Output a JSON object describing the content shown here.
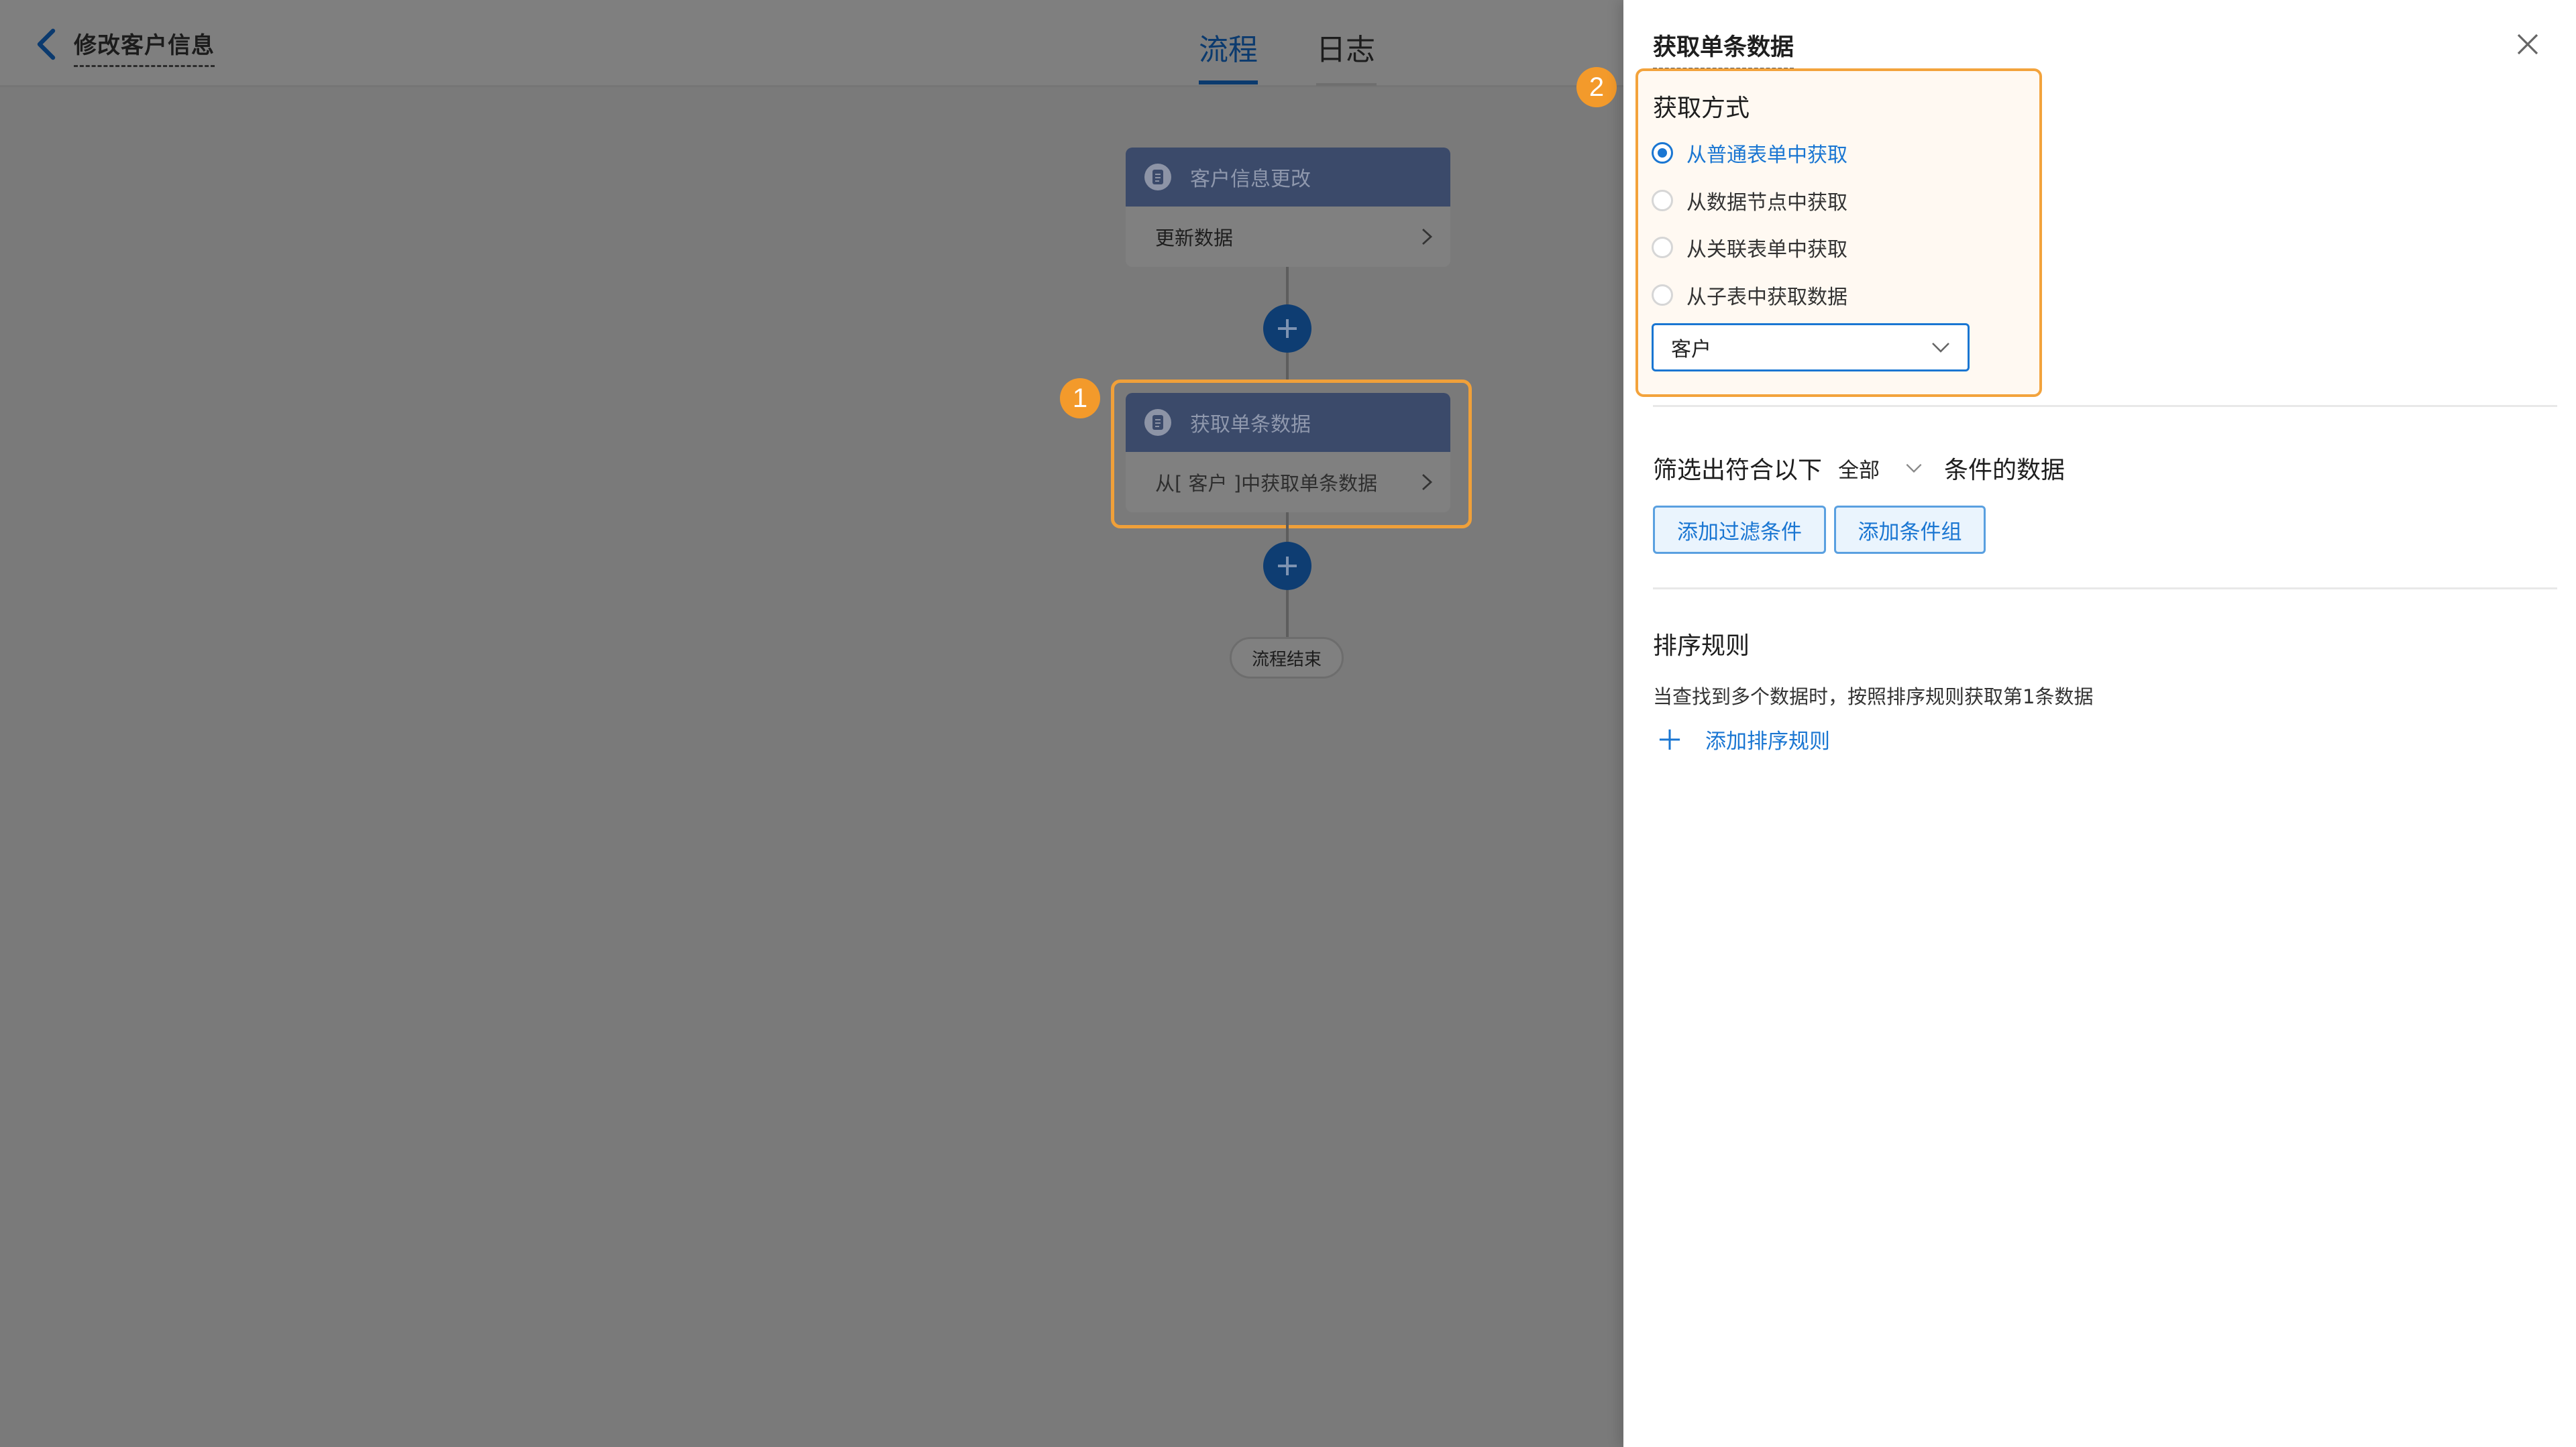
{
  "header": {
    "page_title": "修改客户信息",
    "tabs": [
      {
        "label": "流程",
        "active": true
      },
      {
        "label": "日志",
        "active": false
      }
    ]
  },
  "flow": {
    "nodes": [
      {
        "title": "客户信息更改",
        "body": "更新数据",
        "icon": "form-icon"
      },
      {
        "title": "获取单条数据",
        "body": "从[ 客户 ]中获取单条数据",
        "icon": "form-icon"
      }
    ],
    "end_label": "流程结束",
    "step_badges": [
      "1",
      "2"
    ]
  },
  "panel": {
    "title": "获取单条数据",
    "method_label": "获取方式",
    "methods": [
      {
        "label": "从普通表单中获取",
        "checked": true
      },
      {
        "label": "从数据节点中获取",
        "checked": false
      },
      {
        "label": "从关联表单中获取",
        "checked": false
      },
      {
        "label": "从子表中获取数据",
        "checked": false
      }
    ],
    "source_select": {
      "value": "客户"
    },
    "filter": {
      "prefix": "筛选出符合以下",
      "scope": "全部",
      "suffix": "条件的数据",
      "add_filter_label": "添加过滤条件",
      "add_group_label": "添加条件组"
    },
    "sort": {
      "title": "排序规则",
      "description": "当查找到多个数据时，按照排序规则获取第1条数据",
      "add_label": "添加排序规则"
    }
  },
  "colors": {
    "accent": "#1a76d2",
    "highlight": "#f3a33c",
    "node_header": "#3b4a6a",
    "plus_button": "#0e3d72"
  }
}
